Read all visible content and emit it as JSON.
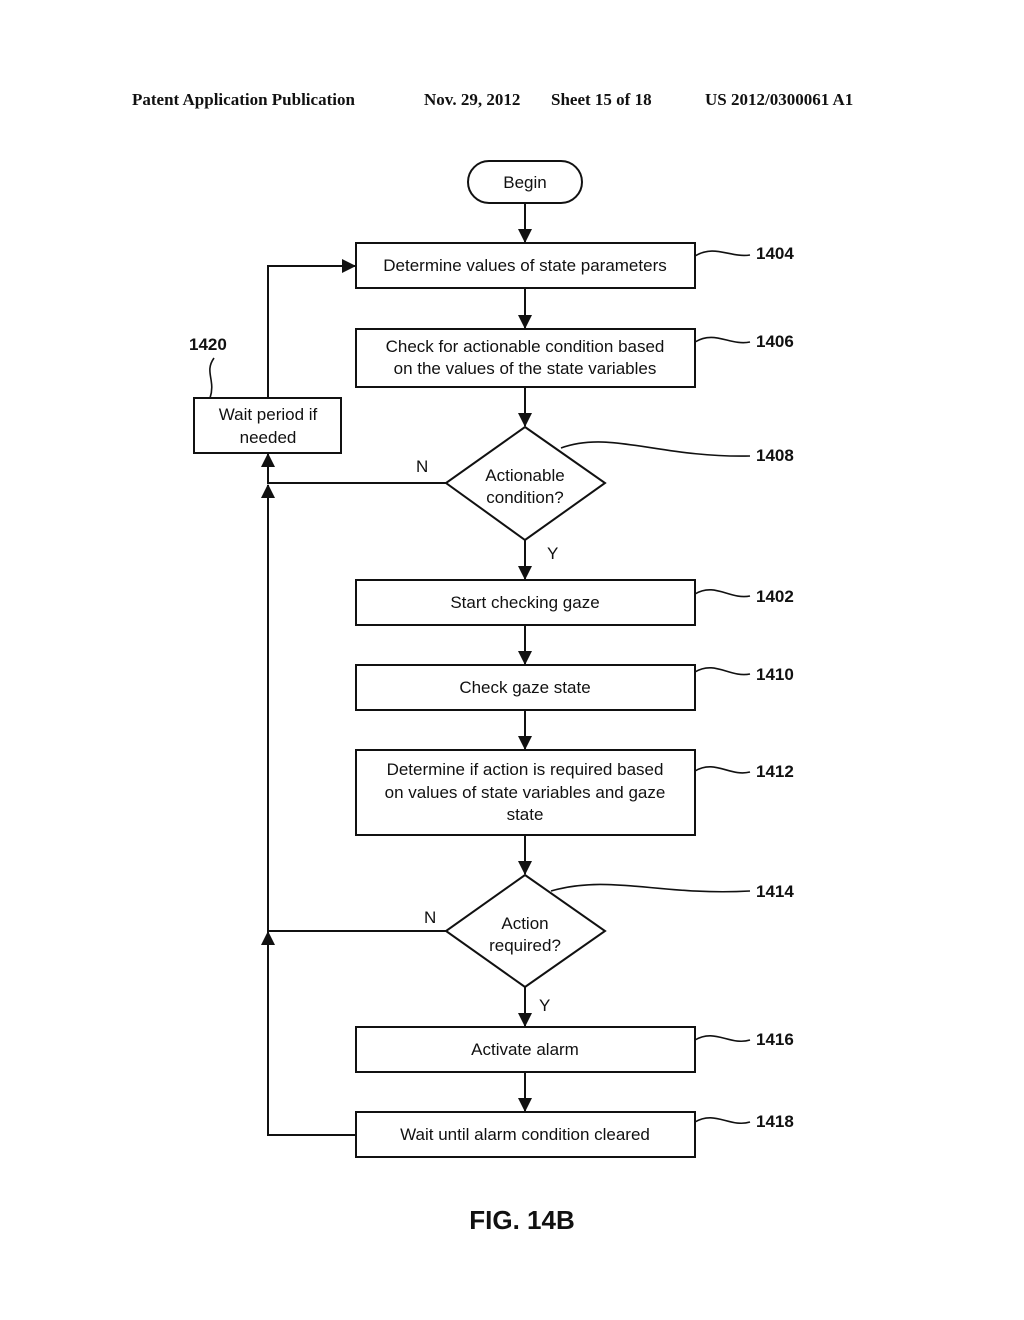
{
  "header": {
    "publication": "Patent Application Publication",
    "date": "Nov. 29, 2012",
    "sheet": "Sheet 15 of 18",
    "number": "US 2012/0300061 A1"
  },
  "figure_label": "FIG. 14B",
  "nodes": {
    "begin": {
      "lines": [
        "Begin"
      ]
    },
    "n1404": {
      "ref": "1404",
      "lines": [
        "Determine values of state parameters"
      ]
    },
    "n1406": {
      "ref": "1406",
      "lines": [
        "Check for actionable condition based",
        "on the values of the state variables"
      ]
    },
    "n1408": {
      "ref": "1408",
      "lines": [
        "Actionable",
        "condition?"
      ]
    },
    "n1402": {
      "ref": "1402",
      "lines": [
        "Start checking gaze"
      ]
    },
    "n1410": {
      "ref": "1410",
      "lines": [
        "Check gaze state"
      ]
    },
    "n1412": {
      "ref": "1412",
      "lines": [
        "Determine if action is required based",
        "on values of state variables and gaze",
        "state"
      ]
    },
    "n1414": {
      "ref": "1414",
      "lines": [
        "Action",
        "required?"
      ]
    },
    "n1416": {
      "ref": "1416",
      "lines": [
        "Activate alarm"
      ]
    },
    "n1418": {
      "ref": "1418",
      "lines": [
        "Wait until alarm condition cleared"
      ]
    },
    "n1420": {
      "ref": "1420",
      "lines": [
        "Wait period if",
        "needed"
      ]
    }
  },
  "edge_labels": {
    "d1408_no": "N",
    "d1408_yes": "Y",
    "d1414_no": "N",
    "d1414_yes": "Y"
  }
}
